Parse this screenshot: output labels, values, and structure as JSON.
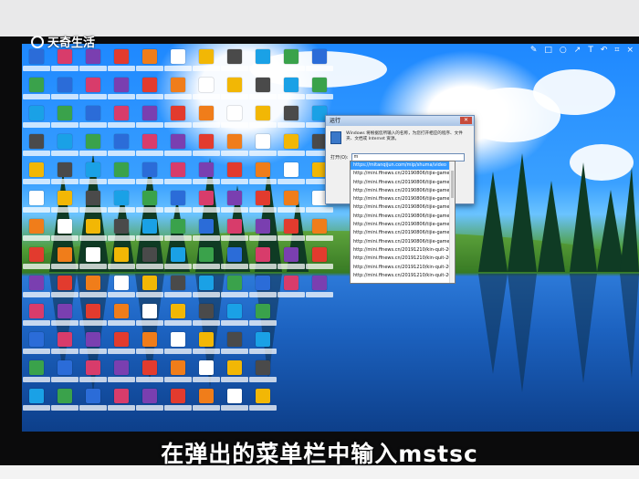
{
  "watermark": {
    "logo_icon": "camera-lens-icon",
    "text": "天奇生活"
  },
  "subtitle": "在弹出的菜单栏中输入mstsc",
  "run_dialog": {
    "title": "运行",
    "description": "Windows 将根据您所输入的名称，为您打开相应的程序、文件夹、文档或 Internet 资源。",
    "open_label": "打开(O):",
    "input_value": "m",
    "dropdown_items": [
      "https://mitanqijun.com/mip/shuma/video",
      "http://mini.ffnews.cn/20190806/tijie-game-v-20",
      "http://mini.ffnews.cn/20190806/tijie-game-v-20",
      "http://mini.ffnews.cn/20190806/tijie-game-v-20",
      "http://mini.ffnews.cn/20190806/tijie-game-v-20",
      "http://mini.ffnews.cn/20190806/tijie-game-v-20",
      "http://mini.ffnews.cn/20190806/tijie-game-v-20",
      "http://mini.ffnews.cn/20190806/tijie-game-v-20",
      "http://mini.ffnews.cn/20190806/tijie-game-v-20",
      "http://mini.ffnews.cn/20190806/tijie-game-v-20",
      "http://mini.ffnews.cn/20191210/kin-quit-2002",
      "http://mini.ffnews.cn/20191210/kin-quit-2002",
      "http://mini.ffnews.cn/20191210/kin-quit-2002",
      "http://mini.ffnews.cn/20191210/kin-quit-2002"
    ]
  },
  "toolbar_icons": [
    "pen-icon",
    "square-icon",
    "circle-icon",
    "arrow-icon",
    "text-icon",
    "undo-icon",
    "crop-icon",
    "close-icon"
  ],
  "colors": {
    "sky": "#3aa0ff",
    "grass": "#4f9d35",
    "lake": "#1c62c0",
    "selection": "#3399ff"
  }
}
